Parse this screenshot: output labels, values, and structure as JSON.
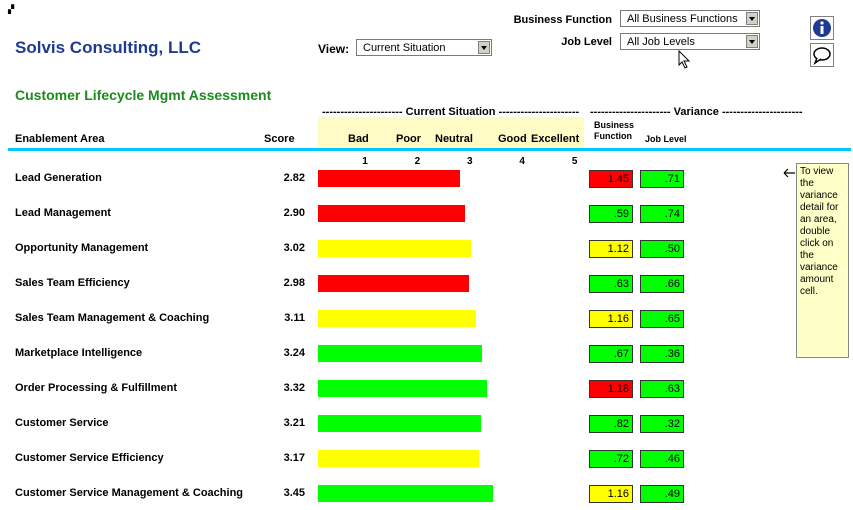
{
  "header": {
    "company": "Solvis Consulting, LLC",
    "subtitle": "Customer Lifecycle Mgmt Assessment",
    "view_label": "View:",
    "view_value": "Current Situation",
    "bf_label": "Business Function",
    "bf_value": "All Business Functions",
    "jl_label": "Job Level",
    "jl_value": "All Job Levels",
    "info_icon": "info-icon",
    "comment_icon": "speech-bubble-icon"
  },
  "columns": {
    "area": "Enablement Area",
    "score": "Score",
    "current_group": "Current Situation",
    "variance_group": "Variance",
    "bad": "Bad",
    "poor": "Poor",
    "neutral": "Neutral",
    "good": "Good",
    "excellent": "Excellent",
    "bf": "Business Function",
    "bf_line1": "Business",
    "bf_line2": "Function",
    "jl": "Job Level",
    "ticks": [
      "1",
      "2",
      "3",
      "4",
      "5"
    ]
  },
  "rows": [
    {
      "area": "Lead Generation",
      "score": "2.82",
      "value": 2.82,
      "status": "red",
      "bf": "1.45",
      "bf_status": "red",
      "jl": ".71",
      "jl_status": "green"
    },
    {
      "area": "Lead Management",
      "score": "2.90",
      "value": 2.9,
      "status": "red",
      "bf": ".59",
      "bf_status": "green",
      "jl": ".74",
      "jl_status": "green"
    },
    {
      "area": "Opportunity Management",
      "score": "3.02",
      "value": 3.02,
      "status": "yellow",
      "bf": "1.12",
      "bf_status": "yellow",
      "jl": ".50",
      "jl_status": "green"
    },
    {
      "area": "Sales Team Efficiency",
      "score": "2.98",
      "value": 2.98,
      "status": "red",
      "bf": ".63",
      "bf_status": "green",
      "jl": ".66",
      "jl_status": "green"
    },
    {
      "area": "Sales Team Management & Coaching",
      "score": "3.11",
      "value": 3.11,
      "status": "yellow",
      "bf": "1.16",
      "bf_status": "yellow",
      "jl": ".65",
      "jl_status": "green"
    },
    {
      "area": "Marketplace Intelligence",
      "score": "3.24",
      "value": 3.24,
      "status": "green",
      "bf": ".67",
      "bf_status": "green",
      "jl": ".36",
      "jl_status": "green"
    },
    {
      "area": "Order Processing & Fulfillment",
      "score": "3.32",
      "value": 3.32,
      "status": "green",
      "bf": "1.18",
      "bf_status": "red",
      "jl": ".63",
      "jl_status": "green"
    },
    {
      "area": "Customer Service",
      "score": "3.21",
      "value": 3.21,
      "status": "green",
      "bf": ".82",
      "bf_status": "green",
      "jl": ".32",
      "jl_status": "green"
    },
    {
      "area": "Customer Service Efficiency",
      "score": "3.17",
      "value": 3.17,
      "status": "yellow",
      "bf": ".72",
      "bf_status": "green",
      "jl": ".46",
      "jl_status": "green"
    },
    {
      "area": "Customer Service Management & Coaching",
      "score": "3.45",
      "value": 3.45,
      "status": "green",
      "bf": "1.16",
      "bf_status": "yellow",
      "jl": ".49",
      "jl_status": "green"
    }
  ],
  "note": {
    "text": "To view the variance detail for an area, double click on the variance amount cell."
  },
  "colors": {
    "red": "#ff0000",
    "yellow": "#ffff00",
    "green": "#00ff00"
  }
}
